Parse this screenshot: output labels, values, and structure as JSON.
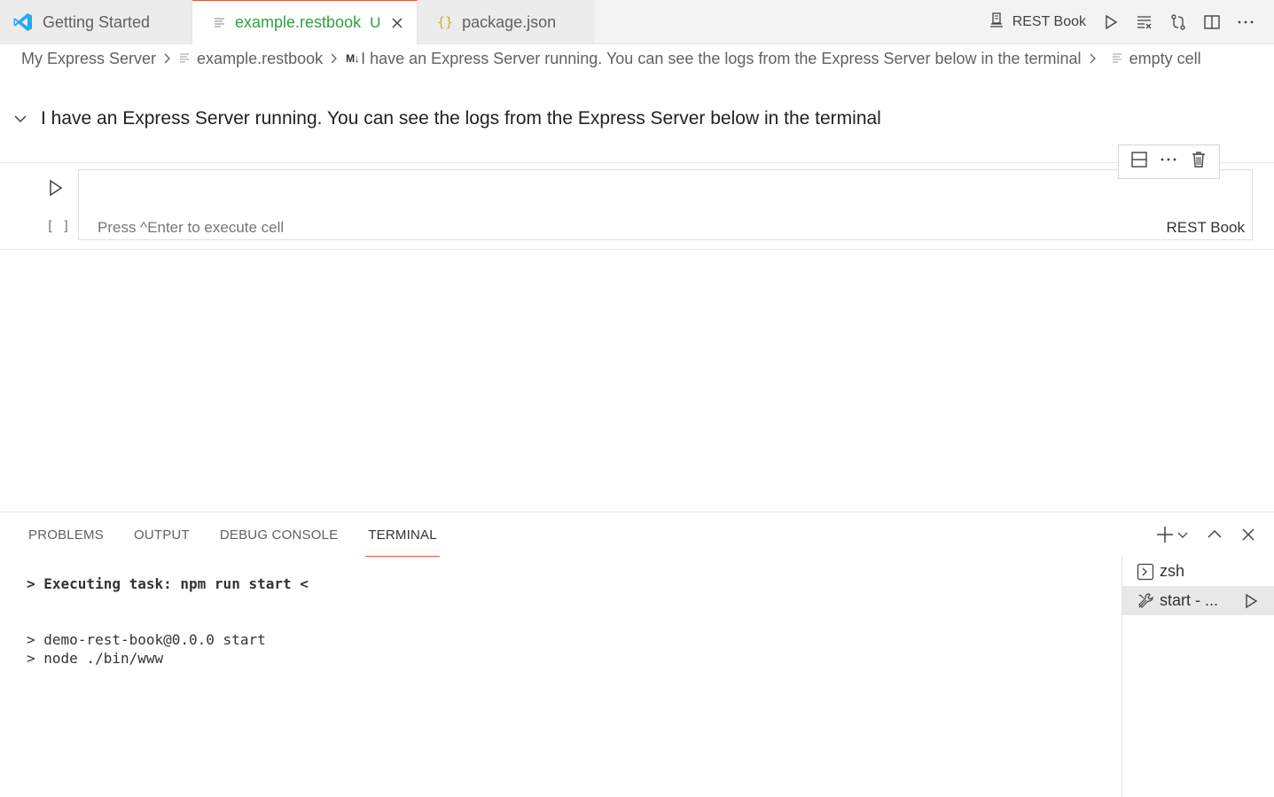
{
  "tabs": [
    {
      "label": "Getting Started",
      "icon": "vscode-logo-icon"
    },
    {
      "label": "example.restbook",
      "status": "U",
      "icon": "file-lines-icon",
      "active": true
    },
    {
      "label": "package.json",
      "icon": "json-braces-icon"
    }
  ],
  "toolbar": {
    "kernel_label": "REST Book"
  },
  "breadcrumb": {
    "items": [
      "My Express Server",
      "example.restbook",
      "I have an Express Server running. You can see the logs from the Express Server below in the terminal",
      "empty cell"
    ],
    "md_badge": "M↓"
  },
  "notebook": {
    "markdown_heading": "I have an Express Server running. You can see the logs from the Express Server below in the terminal",
    "code_cell": {
      "execution_count": "[ ]",
      "placeholder": "Press ^Enter to execute cell",
      "language": "REST Book"
    }
  },
  "panel": {
    "tabs": [
      "PROBLEMS",
      "OUTPUT",
      "DEBUG CONSOLE",
      "TERMINAL"
    ],
    "active_tab": "TERMINAL",
    "terminal_lines": [
      "> Executing task: npm run start <",
      "",
      "",
      "> demo-rest-book@0.0.0 start",
      "> node ./bin/www"
    ],
    "terminals": [
      {
        "label": "zsh",
        "icon": "terminal-icon"
      },
      {
        "label": "start - ...",
        "icon": "tools-icon",
        "selected": true
      }
    ]
  },
  "colors": {
    "accent_modified": "#2ea043",
    "active_tab_border": "#e8583c",
    "vscode_blue": "#23a9f2"
  }
}
